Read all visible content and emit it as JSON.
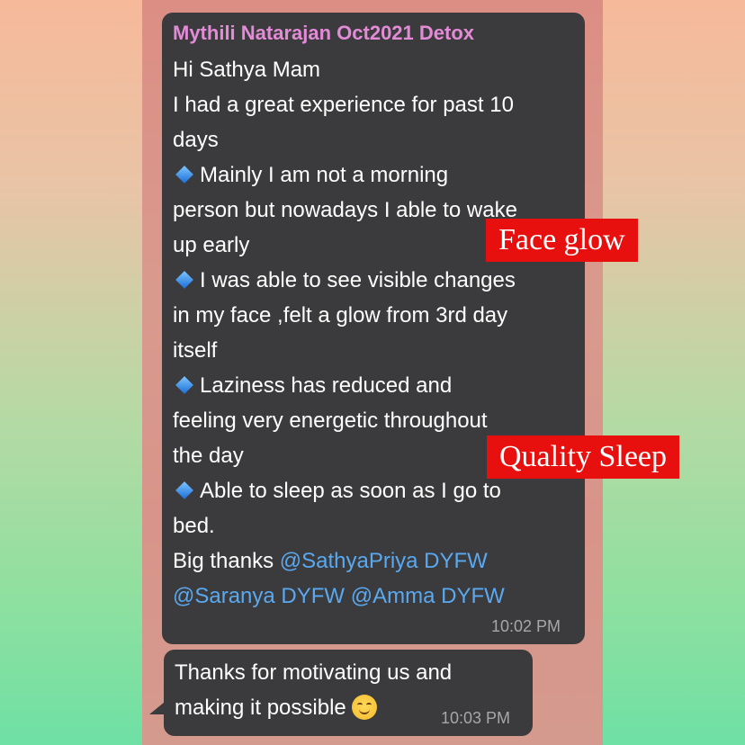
{
  "chat": {
    "message1": {
      "sender": "Mythili Natarajan Oct2021 Detox",
      "lines": [
        "Hi Sathya Mam",
        "I had a great experience for past 10",
        "days",
        "Mainly I am not a morning",
        "person but nowadays I able to wake",
        "up early",
        "I was able to see visible changes",
        "in my face ,felt a glow from 3rd day",
        "itself",
        "Laziness has reduced and",
        "feeling very energetic throughout",
        "the day",
        "Able to sleep as soon as I go to",
        "bed.",
        "Big thanks "
      ],
      "mentions": [
        "@SathyaPriya DYFW",
        "@Saranya DYFW",
        "@Amma DYFW"
      ],
      "time": "10:02 PM"
    },
    "message2": {
      "lines": [
        "Thanks for motivating us and",
        "making it possible"
      ],
      "emoji": "smiling-face",
      "time": "10:03 PM"
    }
  },
  "labels": {
    "face_glow": "Face glow",
    "quality_sleep": "Quality Sleep"
  },
  "colors": {
    "sender": "#e38bd7",
    "mention": "#5aa9f0",
    "bubble": "#3b3b3d",
    "label_bg": "#e8100f"
  }
}
